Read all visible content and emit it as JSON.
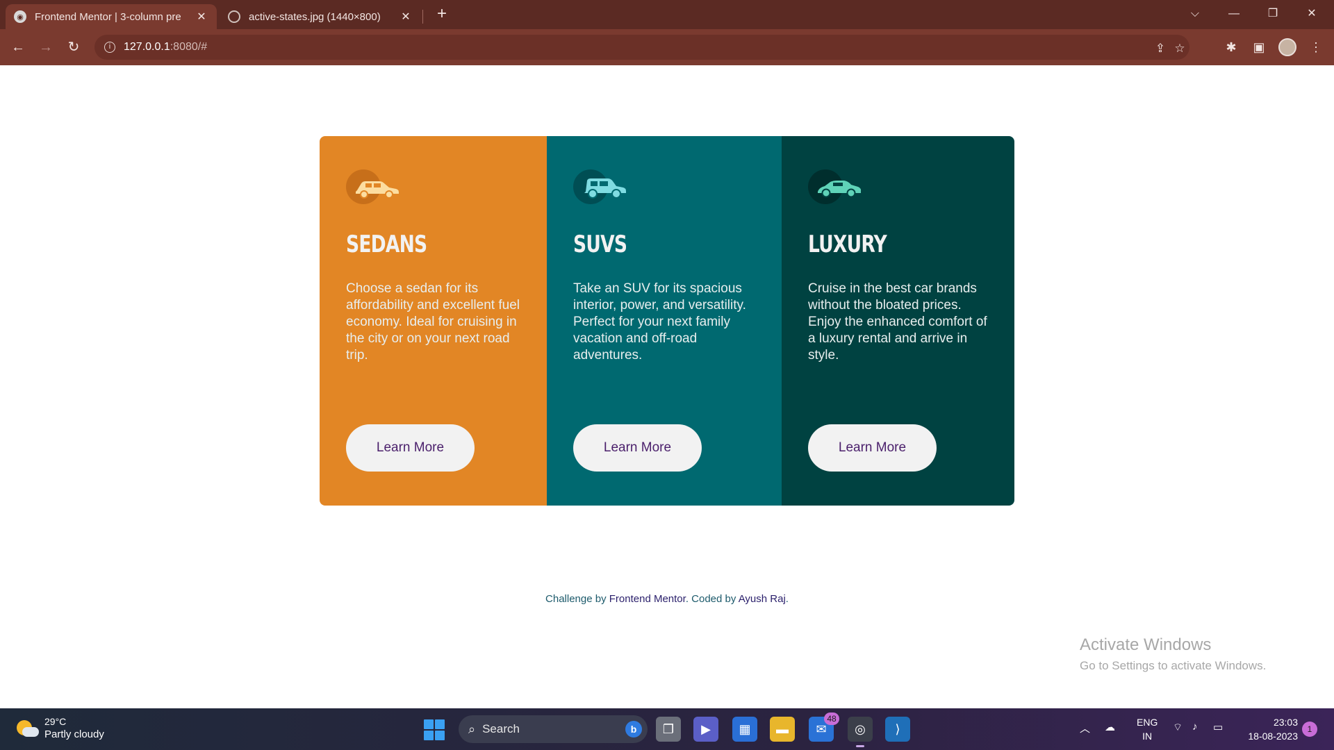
{
  "browser": {
    "tabs": [
      {
        "title": "Frontend Mentor | 3-column pre",
        "active": true
      },
      {
        "title": "active-states.jpg (1440×800)",
        "active": false
      }
    ],
    "new_tab_symbol": "+",
    "url_host": "127.0.0.1",
    "url_rest": ":8080/#",
    "icons": {
      "back": "back-arrow-icon",
      "forward": "forward-arrow-icon",
      "reload": "reload-icon",
      "info": "site-info-icon",
      "share": "share-icon",
      "bookmark": "star-icon",
      "extensions": "puzzle-icon",
      "sidepanel": "side-panel-icon",
      "menu": "kebab-menu-icon"
    }
  },
  "cards": [
    {
      "title": "Sedans",
      "description": "Choose a sedan for its affordability and excellent fuel economy. Ideal for cruising in the city or on your next road trip.",
      "button": "Learn More",
      "color": "#e28625",
      "icon": "sedan-car-icon"
    },
    {
      "title": "SUVs",
      "description": "Take an SUV for its spacious interior, power, and versatility. Perfect for your next family vacation and off-road adventures.",
      "button": "Learn More",
      "color": "#006970",
      "icon": "suv-car-icon"
    },
    {
      "title": "Luxury",
      "description": "Cruise in the best car brands without the bloated prices. Enjoy the enhanced comfort of a luxury rental and arrive in style.",
      "button": "Learn More",
      "color": "#004241",
      "icon": "luxury-car-icon"
    }
  ],
  "footer": {
    "prefix": "Challenge by ",
    "link1": "Frontend Mentor",
    "middle": ". Coded by ",
    "link2": "Ayush Raj",
    "suffix": "."
  },
  "watermark": {
    "title": "Activate Windows",
    "subtitle": "Go to Settings to activate Windows."
  },
  "taskbar": {
    "weather_temp": "29°C",
    "weather_cond": "Partly cloudy",
    "search_label": "Search",
    "mail_badge": "48",
    "lang_top": "ENG",
    "lang_bottom": "IN",
    "time": "23:03",
    "date": "18-08-2023",
    "notifications": "1"
  }
}
